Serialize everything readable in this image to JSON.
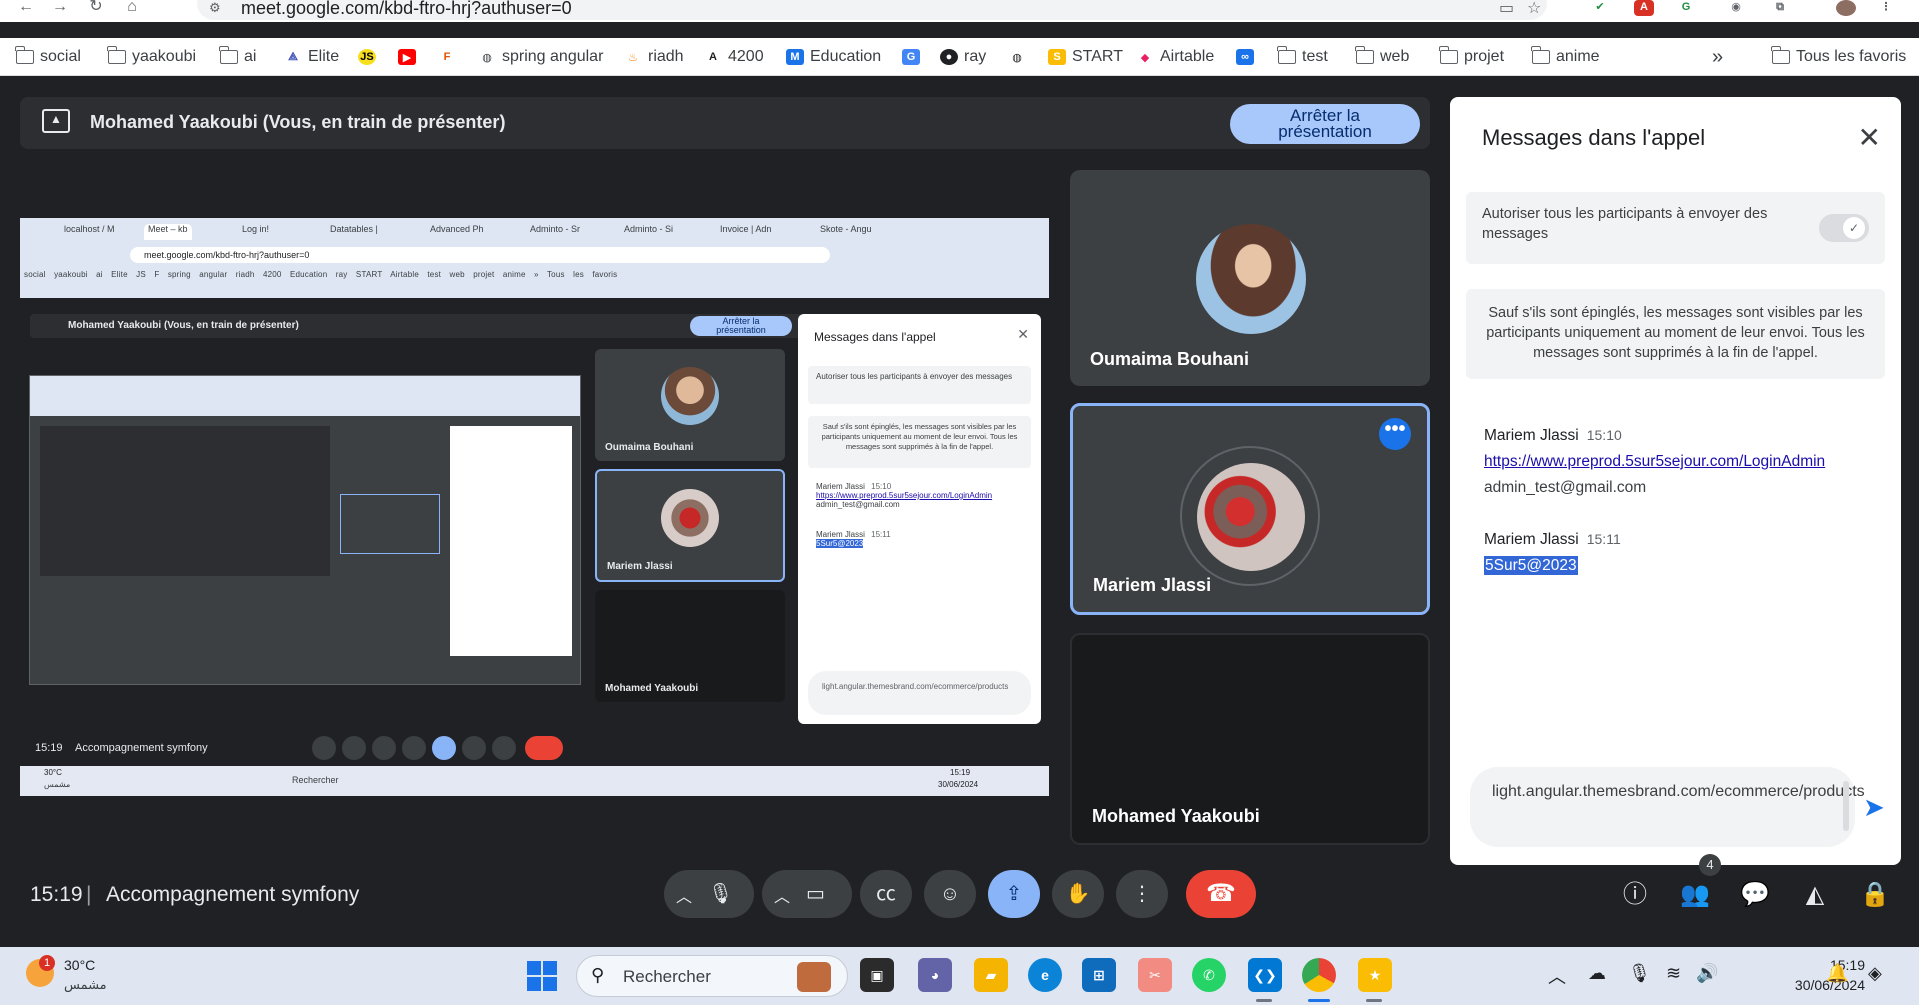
{
  "browser": {
    "url": "meet.google.com/kbd-ftro-hrj?authuser=0",
    "bookmarks": [
      {
        "label": "social",
        "icon": "folder-icon"
      },
      {
        "label": "yaakoubi",
        "icon": "folder-icon"
      },
      {
        "label": "ai",
        "icon": "folder-icon"
      },
      {
        "label": "Elite",
        "icon": "elite-icon"
      },
      {
        "label": "",
        "icon": "js-icon"
      },
      {
        "label": "",
        "icon": "youtube-icon"
      },
      {
        "label": "",
        "icon": "f-icon"
      },
      {
        "label": "spring angular",
        "icon": "globe-icon"
      },
      {
        "label": "riadh",
        "icon": "flame-icon"
      },
      {
        "label": "4200",
        "icon": "angular-icon"
      },
      {
        "label": "Education",
        "icon": "m-icon"
      },
      {
        "label": "",
        "icon": "translate-icon"
      },
      {
        "label": "ray",
        "icon": "ray-icon"
      },
      {
        "label": "",
        "icon": "globe-icon"
      },
      {
        "label": "START",
        "icon": "start-icon"
      },
      {
        "label": "Airtable",
        "icon": "airtable-icon"
      },
      {
        "label": "",
        "icon": "infinity-icon"
      },
      {
        "label": "test",
        "icon": "folder-icon"
      },
      {
        "label": "web",
        "icon": "folder-icon"
      },
      {
        "label": "projet",
        "icon": "folder-icon"
      },
      {
        "label": "anime",
        "icon": "folder-icon"
      }
    ],
    "more_bookmarks": "»",
    "all_bookmarks": "Tous les favoris"
  },
  "banner": {
    "presenting_text": "Mohamed Yaakoubi (Vous, en train de présenter)",
    "stop_line1": "Arrêter la",
    "stop_line2": "présentation"
  },
  "shared_screen": {
    "tabs": [
      "localhost / M",
      "Meet – kb",
      "Log in!",
      "Datatables |",
      "Advanced Ph",
      "Adminto - Sr",
      "Adminto - Si",
      "Invoice | Adn",
      "Skote - Angu"
    ],
    "url": "meet.google.com/kbd-ftro-hrj?authuser=0",
    "bookmarks_line": "social  yaakoubi  ai  Elite  JS  F  spring angular  riadh  4200  Education  ray  START  Airtable  test  web  projet  anime  »  Tous les favoris",
    "banner_text": "Mohamed Yaakoubi (Vous, en train de présenter)",
    "stop_line1": "Arrêter la",
    "stop_line2": "présentation",
    "tiles": [
      "Oumaima Bouhani",
      "Mariem Jlassi",
      "Mohamed Yaakoubi"
    ],
    "chat_title": "Messages dans l'appel",
    "chat_allow": "Autoriser tous les participants à envoyer des messages",
    "chat_info": "Sauf s'ils sont épinglés, les messages sont visibles par les participants uniquement au moment de leur envoi. Tous les messages sont supprimés à la fin de l'appel.",
    "msg1_sender": "Mariem Jlassi",
    "msg1_time": "15:10",
    "msg1_link": "https://www.preprod.5sur5sejour.com/LoginAdmin",
    "msg1_email": "admin_test@gmail.com",
    "msg2_sender": "Mariem Jlassi",
    "msg2_time": "15:11",
    "msg2_text": "5Sur5@2023",
    "chat_input": "light.angular.themesbrand.com/ecommerce/products",
    "time": "15:19",
    "meeting": "Accompagnement symfony",
    "weather_temp": "30°C",
    "weather_desc": "مشمس",
    "search": "Rechercher",
    "tray_time": "15:19",
    "tray_date": "30/06/2024"
  },
  "participants": [
    {
      "name": "Oumaima Bouhani"
    },
    {
      "name": "Mariem Jlassi"
    },
    {
      "name": "Mohamed Yaakoubi"
    }
  ],
  "chat": {
    "title": "Messages dans l'appel",
    "allow_label": "Autoriser tous les participants à envoyer des messages",
    "allow_enabled": true,
    "info": "Sauf s'ils sont épinglés, les messages sont visibles par les participants uniquement au moment de leur envoi. Tous les messages sont supprimés à la fin de l'appel.",
    "messages": [
      {
        "sender": "Mariem Jlassi",
        "time": "15:10",
        "lines": [
          "https://www.preprod.5sur5sejour.com/LoginAdmin",
          "admin_test@gmail.com"
        ]
      },
      {
        "sender": "Mariem Jlassi",
        "time": "15:11",
        "lines": [
          "5Sur5@2023"
        ]
      }
    ],
    "input_value": "light.angular.themesbrand.com/ecommerce/products"
  },
  "meeting": {
    "time": "15:19",
    "separator": "|",
    "title": "Accompagnement symfony",
    "people_count": "4"
  },
  "taskbar": {
    "weather_badge": "1",
    "weather_temp": "30°C",
    "weather_desc": "مشمس",
    "search_placeholder": "Rechercher",
    "time": "15:19",
    "date": "30/06/2024"
  },
  "colors": {
    "accent": "#8ab4f8",
    "leave": "#ea4335",
    "stage_bg": "#202124",
    "tile_bg": "#3c4043"
  }
}
